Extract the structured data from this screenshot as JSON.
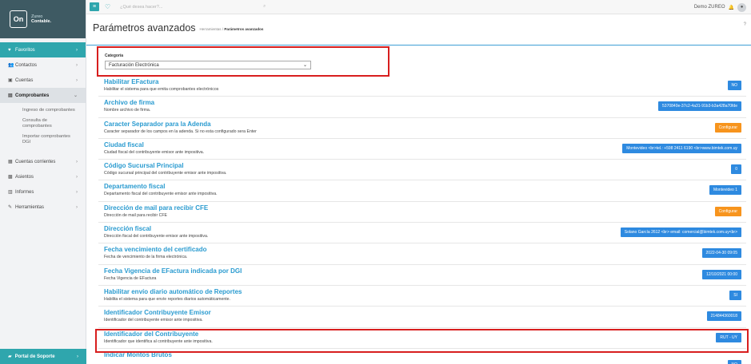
{
  "brand": {
    "logo": "On",
    "name_top": "Zureo",
    "name_bottom": "Contable."
  },
  "sidebar": {
    "items": [
      {
        "label": "Favoritos",
        "icon": "heart-icon"
      },
      {
        "label": "Contactos",
        "icon": "users-icon"
      },
      {
        "label": "Cuentas",
        "icon": "bank-icon"
      },
      {
        "label": "Comprobantes",
        "icon": "document-icon"
      },
      {
        "label": "Cuentas corrientes",
        "icon": "ledger-icon"
      },
      {
        "label": "Asientos",
        "icon": "book-icon"
      },
      {
        "label": "Informes",
        "icon": "report-icon"
      },
      {
        "label": "Herramientas",
        "icon": "wrench-icon"
      }
    ],
    "subitems": [
      "Ingreso de comprobantes",
      "Consulta de comprobantes",
      "Importar comprobantes DGI"
    ],
    "support": "Portal de Soporte"
  },
  "topbar": {
    "search_placeholder": "¿Qué desea hacer?...",
    "user": "Demo ZUREO"
  },
  "header": {
    "title": "Parámetros avanzados",
    "breadcrumb_root": "Herramientas",
    "breadcrumb_current": "Parámetros avanzados"
  },
  "category": {
    "label": "Categoría",
    "selected": "Facturación Electrónica"
  },
  "params": [
    {
      "name": "Habilitar EFactura",
      "desc": "Habilitar el sistema para que emita comprobantes electrónicos",
      "value": "NO"
    },
    {
      "name": "Archivo de firma",
      "desc": "Nombre archivo de firma.",
      "value": "5370840e-37c2-4a31-91b3-b3a428a70fde"
    },
    {
      "name": "Caracter Separador para la Adenda",
      "desc": "Caracter separador de los campos en la adenda. Si no esta configurado sera Enter",
      "value": "Configurar"
    },
    {
      "name": "Ciudad fiscal",
      "desc": "Ciudad fiscal del contribuyente emisor ante impositiva.",
      "value": "Montevideo <br>tel.: +598 2411 6190 <br>www.bimtek.com.uy"
    },
    {
      "name": "Código Sucursal Principal",
      "desc": "Código sucursal principal del contribuyente emisor ante impositiva.",
      "value": "0"
    },
    {
      "name": "Departamento fiscal",
      "desc": "Departamento fiscal del contribuyente emisor ante impositiva.",
      "value": "Montevideo 1"
    },
    {
      "name": "Dirección de mail para recibir CFE",
      "desc": "Dirección de mail para recibir CFE",
      "value": "Configurar"
    },
    {
      "name": "Dirección fiscal",
      "desc": "Dirección fiscal del contribuyente emisor ante impositiva.",
      "value": "Solano García 2612 <br> email: comercial@bimtek.com.uy<br>"
    },
    {
      "name": "Fecha vencimiento del certificado",
      "desc": "Fecha de vencimiento de la firma electrónica.",
      "value": "2022-04-30 09:05"
    },
    {
      "name": "Fecha Vigencia de EFactura indicada por DGI",
      "desc": "Fecha Vigencia de EFactura",
      "value": "12/10/2021 00:00"
    },
    {
      "name": "Habilitar envío diario automático de Reportes",
      "desc": "Habilita el sistema para que envíe reportes diarios automáticamente.",
      "value": "SI"
    },
    {
      "name": "Identificador Contribuyente Emisor",
      "desc": "Identificador del contribuyente emisor ante impositiva.",
      "value": "214844360018"
    },
    {
      "name": "Identificador del Contribuyente",
      "desc": "Identificador que identifica al contribuyente ante impositiva.",
      "value": "RUT - UY"
    },
    {
      "name": "Indicar Montos Brutos",
      "desc": "",
      "value": "NO"
    }
  ],
  "colors": {
    "accent": "#2fa6ad",
    "link": "#2a9bd0",
    "button": "#2e8ae0",
    "warning": "#f7941d",
    "highlight": "#d81e1e"
  }
}
